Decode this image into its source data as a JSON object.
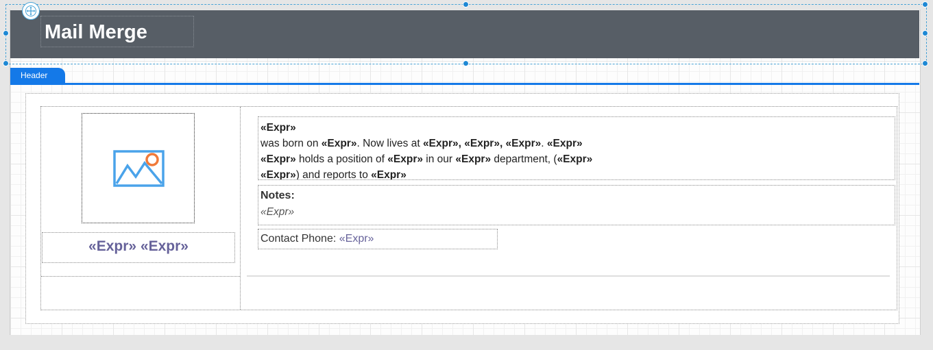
{
  "report": {
    "title": "Mail Merge",
    "band_label": "Header"
  },
  "detail": {
    "photo_icon": "image-placeholder-icon",
    "name_first": "«Expr»",
    "name_last": "«Expr»",
    "bio": {
      "line1_expr": "«Expr»",
      "born_text": " was born on ",
      "born_expr": "«Expr»",
      "lives_text": ". Now lives at ",
      "address_expr": "«Expr», «Expr», «Expr»",
      "period": ". ",
      "line2_end_expr": "«Expr»",
      "line3_expr1": "«Expr»",
      "position_text": " holds a position of ",
      "position_expr": "«Expr»",
      "in_our_text": " in our ",
      "department_expr": "«Expr»",
      "department_text": " department, (",
      "line3_end_expr": "«Expr»",
      "line4_expr": "«Expr»",
      "reports_text": ") and reports to ",
      "reports_expr": "«Expr»"
    },
    "notes_label": "Notes:",
    "notes_value": "«Expr»",
    "phone_label": "Contact Phone: ",
    "phone_value": "«Expr»"
  },
  "colors": {
    "header_band": "#575e66",
    "band_tab": "#1479e8",
    "expression_accent": "#66629a",
    "selection": "#46a2d6"
  }
}
